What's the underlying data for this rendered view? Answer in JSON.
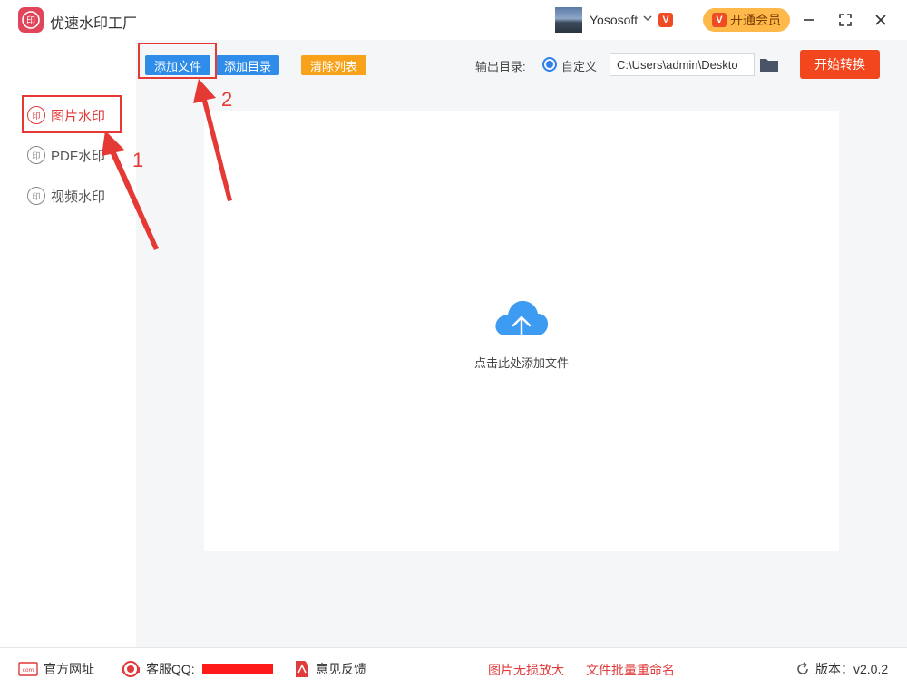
{
  "app": {
    "title": "优速水印工厂"
  },
  "user": {
    "name": "Yososoft",
    "vip_badge": "V",
    "vip_button": "开通会员"
  },
  "sidebar": {
    "items": [
      {
        "label": "图片水印",
        "icon": "watermark-stamp-icon",
        "active": true
      },
      {
        "label": "PDF水印",
        "icon": "watermark-stamp-icon",
        "active": false
      },
      {
        "label": "视频水印",
        "icon": "watermark-stamp-icon",
        "active": false
      }
    ]
  },
  "toolbar": {
    "add_file": "添加文件",
    "add_dir": "添加目录",
    "clear_list": "清除列表",
    "output_label": "输出目录:",
    "radio_custom": "自定义",
    "output_path": "C:\\Users\\admin\\Deskto",
    "start": "开始转换"
  },
  "dropzone": {
    "text": "点击此处添加文件",
    "icon": "cloud-upload-icon"
  },
  "annotations": {
    "step1": "1",
    "step2": "2"
  },
  "footer": {
    "website": "官方网址",
    "qq": "客服QQ:",
    "feedback": "意见反馈",
    "link1": "图片无损放大",
    "link2": "文件批量重命名",
    "version": "版本：v2.0.2"
  },
  "colors": {
    "accent_blue": "#2f8ce8",
    "accent_orange": "#f8a21b",
    "start_red": "#f2461e",
    "annotation_red": "#e53935"
  }
}
